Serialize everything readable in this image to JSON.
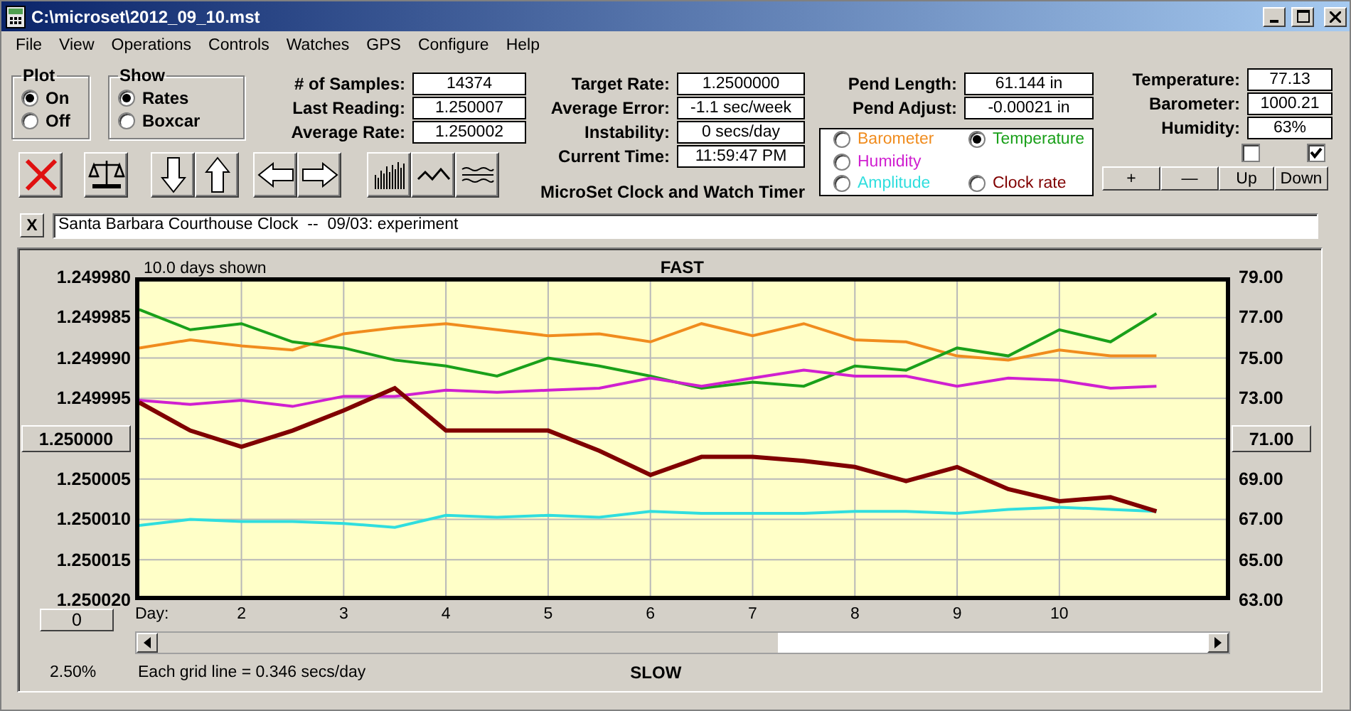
{
  "window": {
    "title": "C:\\microset\\2012_09_10.mst"
  },
  "menu": [
    "File",
    "View",
    "Operations",
    "Controls",
    "Watches",
    "GPS",
    "Configure",
    "Help"
  ],
  "plot_group": {
    "title": "Plot",
    "options": [
      {
        "label": "On",
        "selected": true
      },
      {
        "label": "Off",
        "selected": false
      }
    ]
  },
  "show_group": {
    "title": "Show",
    "options": [
      {
        "label": "Rates",
        "selected": true
      },
      {
        "label": "Boxcar",
        "selected": false
      }
    ]
  },
  "samples": [
    {
      "label": "# of Samples:",
      "value": "14374"
    },
    {
      "label": "Last Reading:",
      "value": "1.250007"
    },
    {
      "label": "Average Rate:",
      "value": "1.250002"
    }
  ],
  "rates": [
    {
      "label": "Target Rate:",
      "value": "1.2500000"
    },
    {
      "label": "Average Error:",
      "value": "-1.1 sec/week"
    },
    {
      "label": "Instability:",
      "value": "0 secs/day"
    },
    {
      "label": "Current Time:",
      "value": "11:59:47 PM"
    }
  ],
  "app_name": "MicroSet Clock and Watch Timer",
  "pendulum": [
    {
      "label": "Pend Length:",
      "value": "61.144 in"
    },
    {
      "label": "Pend Adjust:",
      "value": "-0.00021 in"
    }
  ],
  "legend": [
    {
      "selected": false
    },
    {
      "selected": true
    },
    {
      "selected": false
    },
    {
      "selected": false
    },
    {
      "selected": false
    }
  ],
  "environment": [
    {
      "label": "Temperature:",
      "value": "77.13"
    },
    {
      "label": "Barometer:",
      "value": "1000.21"
    },
    {
      "label": "Humidity:",
      "value": "63%"
    }
  ],
  "checkboxes": [
    {
      "checked": false
    },
    {
      "checked": true
    }
  ],
  "adjust_buttons": [
    "+",
    "—",
    "Up",
    "Down"
  ],
  "note": {
    "close": "X",
    "value": "Santa Barbara Courthouse Clock  --  09/03: experiment"
  },
  "chart": {
    "days_shown": "10.0 days shown",
    "top_label": "FAST",
    "bottom_label": "SLOW",
    "left_axis_labels": [
      "1.249980",
      "1.249985",
      "1.249990",
      "1.249995",
      "1.250005",
      "1.250010",
      "1.250015",
      "1.250020"
    ],
    "left_center_button": "1.250000",
    "right_center_button": "71.00",
    "zero_button": "0",
    "day_label": "Day:",
    "percent": "2.50%",
    "grid_note": "Each grid line = 0.346 secs/day",
    "chart_data": {
      "type": "line",
      "grid": true,
      "x": [
        1,
        1.5,
        2,
        2.5,
        3,
        3.5,
        4,
        4.5,
        5,
        5.5,
        6,
        6.5,
        7,
        7.5,
        8,
        8.5,
        9,
        9.5,
        10,
        10.5,
        10.95
      ],
      "xlim": [
        0.96,
        11.67
      ],
      "ylim": [
        63,
        79
      ],
      "xticks": [
        {
          "value": 2,
          "label": "2"
        },
        {
          "value": 3,
          "label": "3"
        },
        {
          "value": 4,
          "label": "4"
        },
        {
          "value": 5,
          "label": "5"
        },
        {
          "value": 6,
          "label": "6"
        },
        {
          "value": 7,
          "label": "7"
        },
        {
          "value": 8,
          "label": "8"
        },
        {
          "value": 9,
          "label": "9"
        },
        {
          "value": 10,
          "label": "10"
        }
      ],
      "yticks": [
        {
          "value": 79,
          "label": "79.00"
        },
        {
          "value": 77,
          "label": "77.00"
        },
        {
          "value": 75,
          "label": "75.00"
        },
        {
          "value": 73,
          "label": "73.00"
        },
        {
          "value": 69,
          "label": "69.00"
        },
        {
          "value": 67,
          "label": "67.00"
        },
        {
          "value": 65,
          "label": "65.00"
        },
        {
          "value": 63,
          "label": "63.00"
        }
      ],
      "series": [
        {
          "name": "Barometer",
          "color": "#f08c1e",
          "values": [
            75.5,
            75.9,
            75.6,
            75.4,
            76.2,
            76.5,
            76.7,
            76.4,
            76.1,
            76.2,
            75.8,
            76.7,
            76.1,
            76.7,
            75.9,
            75.8,
            75.1,
            74.9,
            75.4,
            75.1,
            75.1
          ]
        },
        {
          "name": "Temperature",
          "color": "#1aa01a",
          "values": [
            77.4,
            76.4,
            76.7,
            75.8,
            75.5,
            74.9,
            74.6,
            74.1,
            75.0,
            74.6,
            74.1,
            73.5,
            73.8,
            73.6,
            74.6,
            74.4,
            75.5,
            75.1,
            76.4,
            75.8,
            77.2
          ]
        },
        {
          "name": "Humidity",
          "color": "#d020d0",
          "values": [
            72.9,
            72.7,
            72.9,
            72.6,
            73.1,
            73.1,
            73.4,
            73.3,
            73.4,
            73.5,
            74.0,
            73.6,
            74.0,
            74.4,
            74.1,
            74.1,
            73.6,
            74.0,
            73.9,
            73.5,
            73.6
          ]
        },
        {
          "name": "Amplitude",
          "color": "#30dede",
          "values": [
            66.7,
            67.0,
            66.9,
            66.9,
            66.8,
            66.6,
            67.2,
            67.1,
            67.2,
            67.1,
            67.4,
            67.3,
            67.3,
            67.3,
            67.4,
            67.4,
            67.3,
            67.5,
            67.6,
            67.5,
            67.4
          ]
        },
        {
          "name": "Clock rate",
          "color": "#800000",
          "values": [
            72.8,
            71.4,
            70.6,
            71.4,
            72.4,
            73.5,
            71.4,
            71.4,
            71.4,
            70.4,
            69.2,
            70.1,
            70.1,
            69.9,
            69.6,
            68.9,
            69.6,
            68.5,
            67.9,
            68.1,
            67.4
          ]
        }
      ]
    }
  }
}
